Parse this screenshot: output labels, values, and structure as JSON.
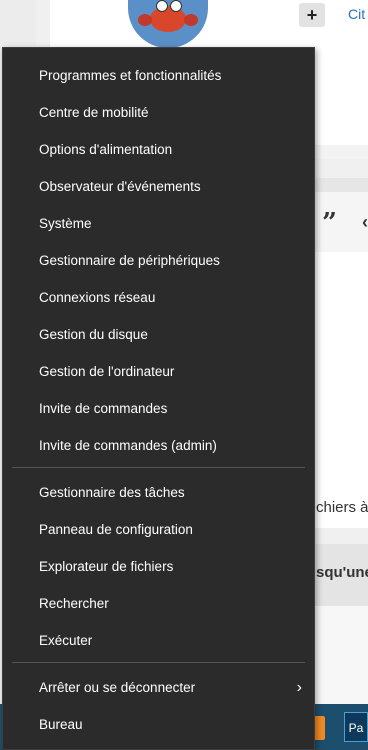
{
  "background": {
    "cite_link": "Cit",
    "quote_glyph": "”",
    "angle_glyph": "‹",
    "text_fichiers": "chiers à",
    "text_squune": "squ'une",
    "taskbar_icon_label": "Pa"
  },
  "menu": {
    "group1": [
      {
        "label": "Programmes et fonctionnalités"
      },
      {
        "label": "Centre de mobilité"
      },
      {
        "label": "Options d'alimentation"
      },
      {
        "label": "Observateur d'événements"
      },
      {
        "label": "Système"
      },
      {
        "label": "Gestionnaire de périphériques"
      },
      {
        "label": "Connexions réseau"
      },
      {
        "label": "Gestion du disque"
      },
      {
        "label": "Gestion de l'ordinateur"
      },
      {
        "label": "Invite de commandes"
      },
      {
        "label": "Invite de commandes (admin)"
      }
    ],
    "group2": [
      {
        "label": "Gestionnaire des tâches"
      },
      {
        "label": "Panneau de configuration"
      },
      {
        "label": "Explorateur de fichiers"
      },
      {
        "label": "Rechercher"
      },
      {
        "label": "Exécuter"
      }
    ],
    "group3": [
      {
        "label": "Arrêter ou se déconnecter",
        "has_submenu": true
      },
      {
        "label": "Bureau"
      }
    ]
  },
  "colors": {
    "menu_bg": "#2b2b2b",
    "menu_text": "#ffffff",
    "separator": "#555555"
  }
}
